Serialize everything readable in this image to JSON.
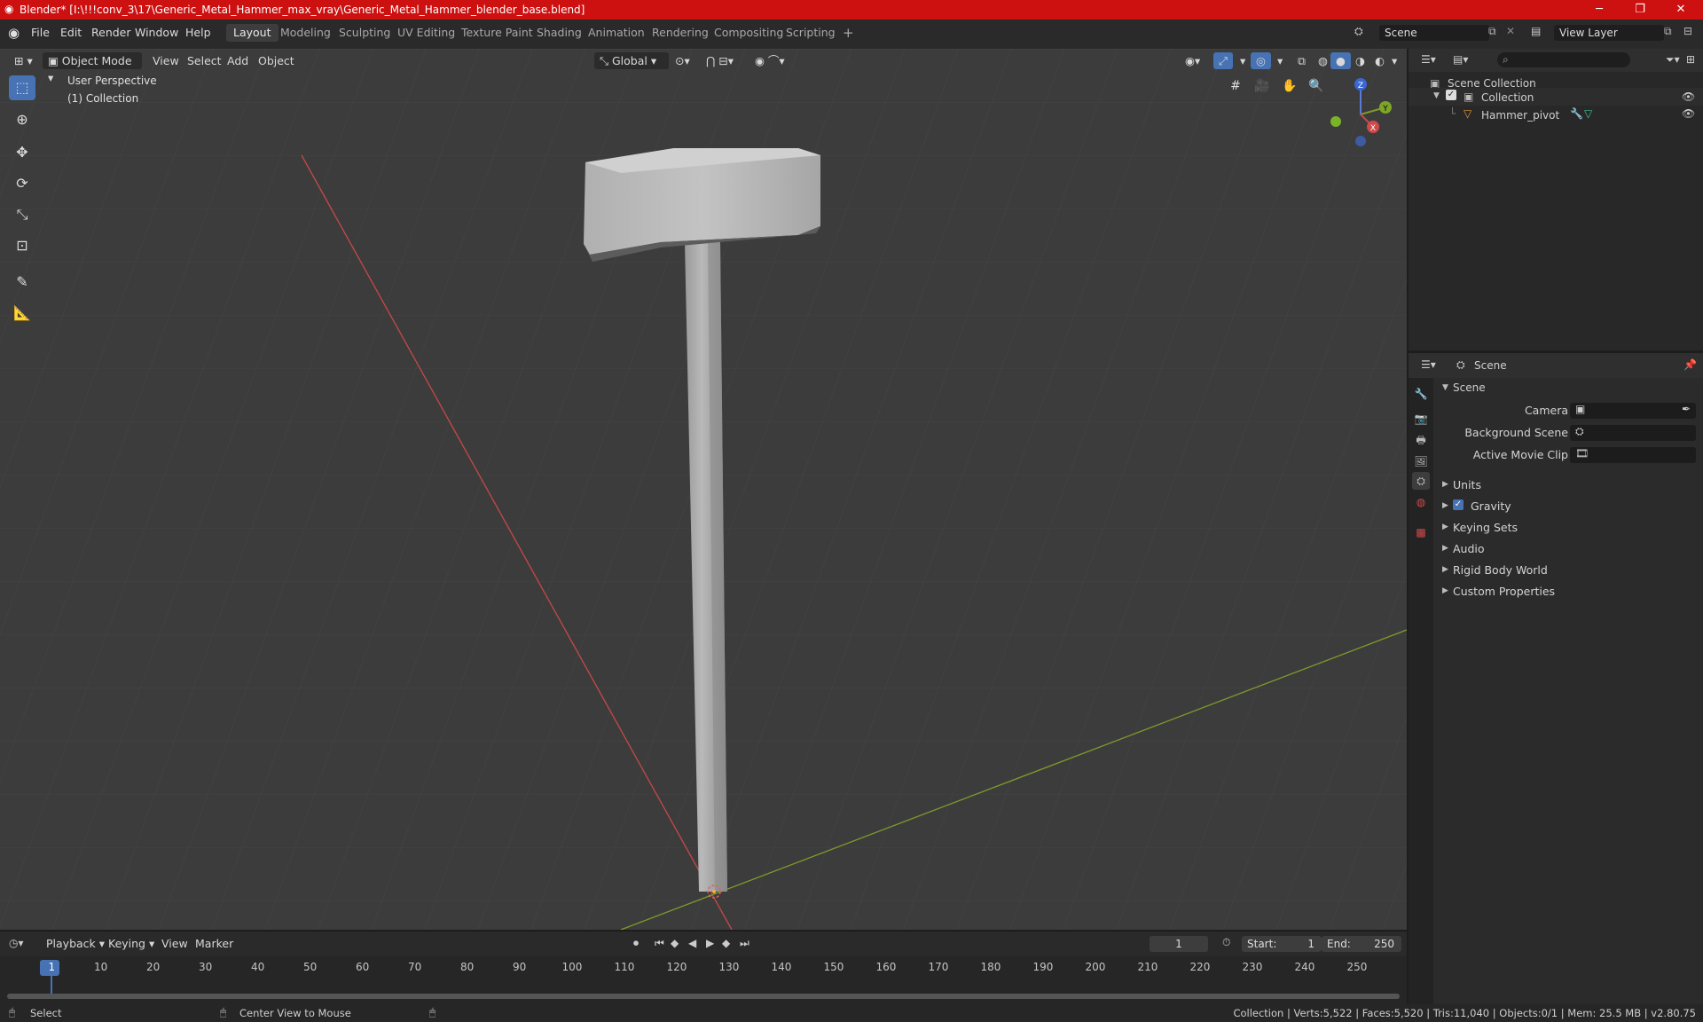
{
  "window": {
    "title": "Blender* [I:\\!!!conv_3\\17\\Generic_Metal_Hammer_max_vray\\Generic_Metal_Hammer_blender_base.blend]",
    "minimize": "─",
    "maximize": "❐",
    "close": "✕"
  },
  "menu": [
    "File",
    "Edit",
    "Render",
    "Window",
    "Help"
  ],
  "workspaces": [
    "Layout",
    "Modeling",
    "Sculpting",
    "UV Editing",
    "Texture Paint",
    "Shading",
    "Animation",
    "Rendering",
    "Compositing",
    "Scripting"
  ],
  "workspace_add": "+",
  "scene_selector": {
    "value": "Scene"
  },
  "view_layer_selector": {
    "value": "View Layer"
  },
  "viewport": {
    "mode": "Object Mode",
    "menus": [
      "View",
      "Select",
      "Add",
      "Object"
    ],
    "orientation": "Global",
    "overlay_title": "User Perspective",
    "overlay_collection": "(1) Collection",
    "gizmo": {
      "x": "X",
      "y": "Y",
      "z": "Z"
    }
  },
  "outliner": {
    "search_placeholder": "",
    "root": "Scene Collection",
    "collection": "Collection",
    "object": "Hammer_pivot"
  },
  "properties": {
    "context": "Scene",
    "panel": "Scene",
    "camera_label": "Camera",
    "background_scene_label": "Background Scene",
    "active_movie_clip_label": "Active Movie Clip",
    "sections": [
      "Units",
      "Gravity",
      "Keying Sets",
      "Audio",
      "Rigid Body World",
      "Custom Properties"
    ],
    "gravity_checked": true
  },
  "timeline": {
    "menus": [
      "Playback",
      "Keying",
      "View",
      "Marker"
    ],
    "current_frame": "1",
    "start_label": "Start:",
    "start_value": "1",
    "end_label": "End:",
    "end_value": "250",
    "ticks": [
      "1",
      "10",
      "20",
      "30",
      "40",
      "50",
      "60",
      "70",
      "80",
      "90",
      "100",
      "110",
      "120",
      "130",
      "140",
      "150",
      "160",
      "170",
      "180",
      "190",
      "200",
      "210",
      "220",
      "230",
      "240",
      "250"
    ]
  },
  "status": {
    "select": "Select",
    "center_view": "Center View to Mouse",
    "stats": "Collection | Verts:5,522 | Faces:5,520 | Tris:11,040 | Objects:0/1 | Mem: 25.5 MB | v2.80.75"
  },
  "colors": {
    "title_bar": "#cd1010",
    "accent": "#4772b3",
    "x_axis": "#c74848",
    "y_axis": "#7e9b2a"
  }
}
